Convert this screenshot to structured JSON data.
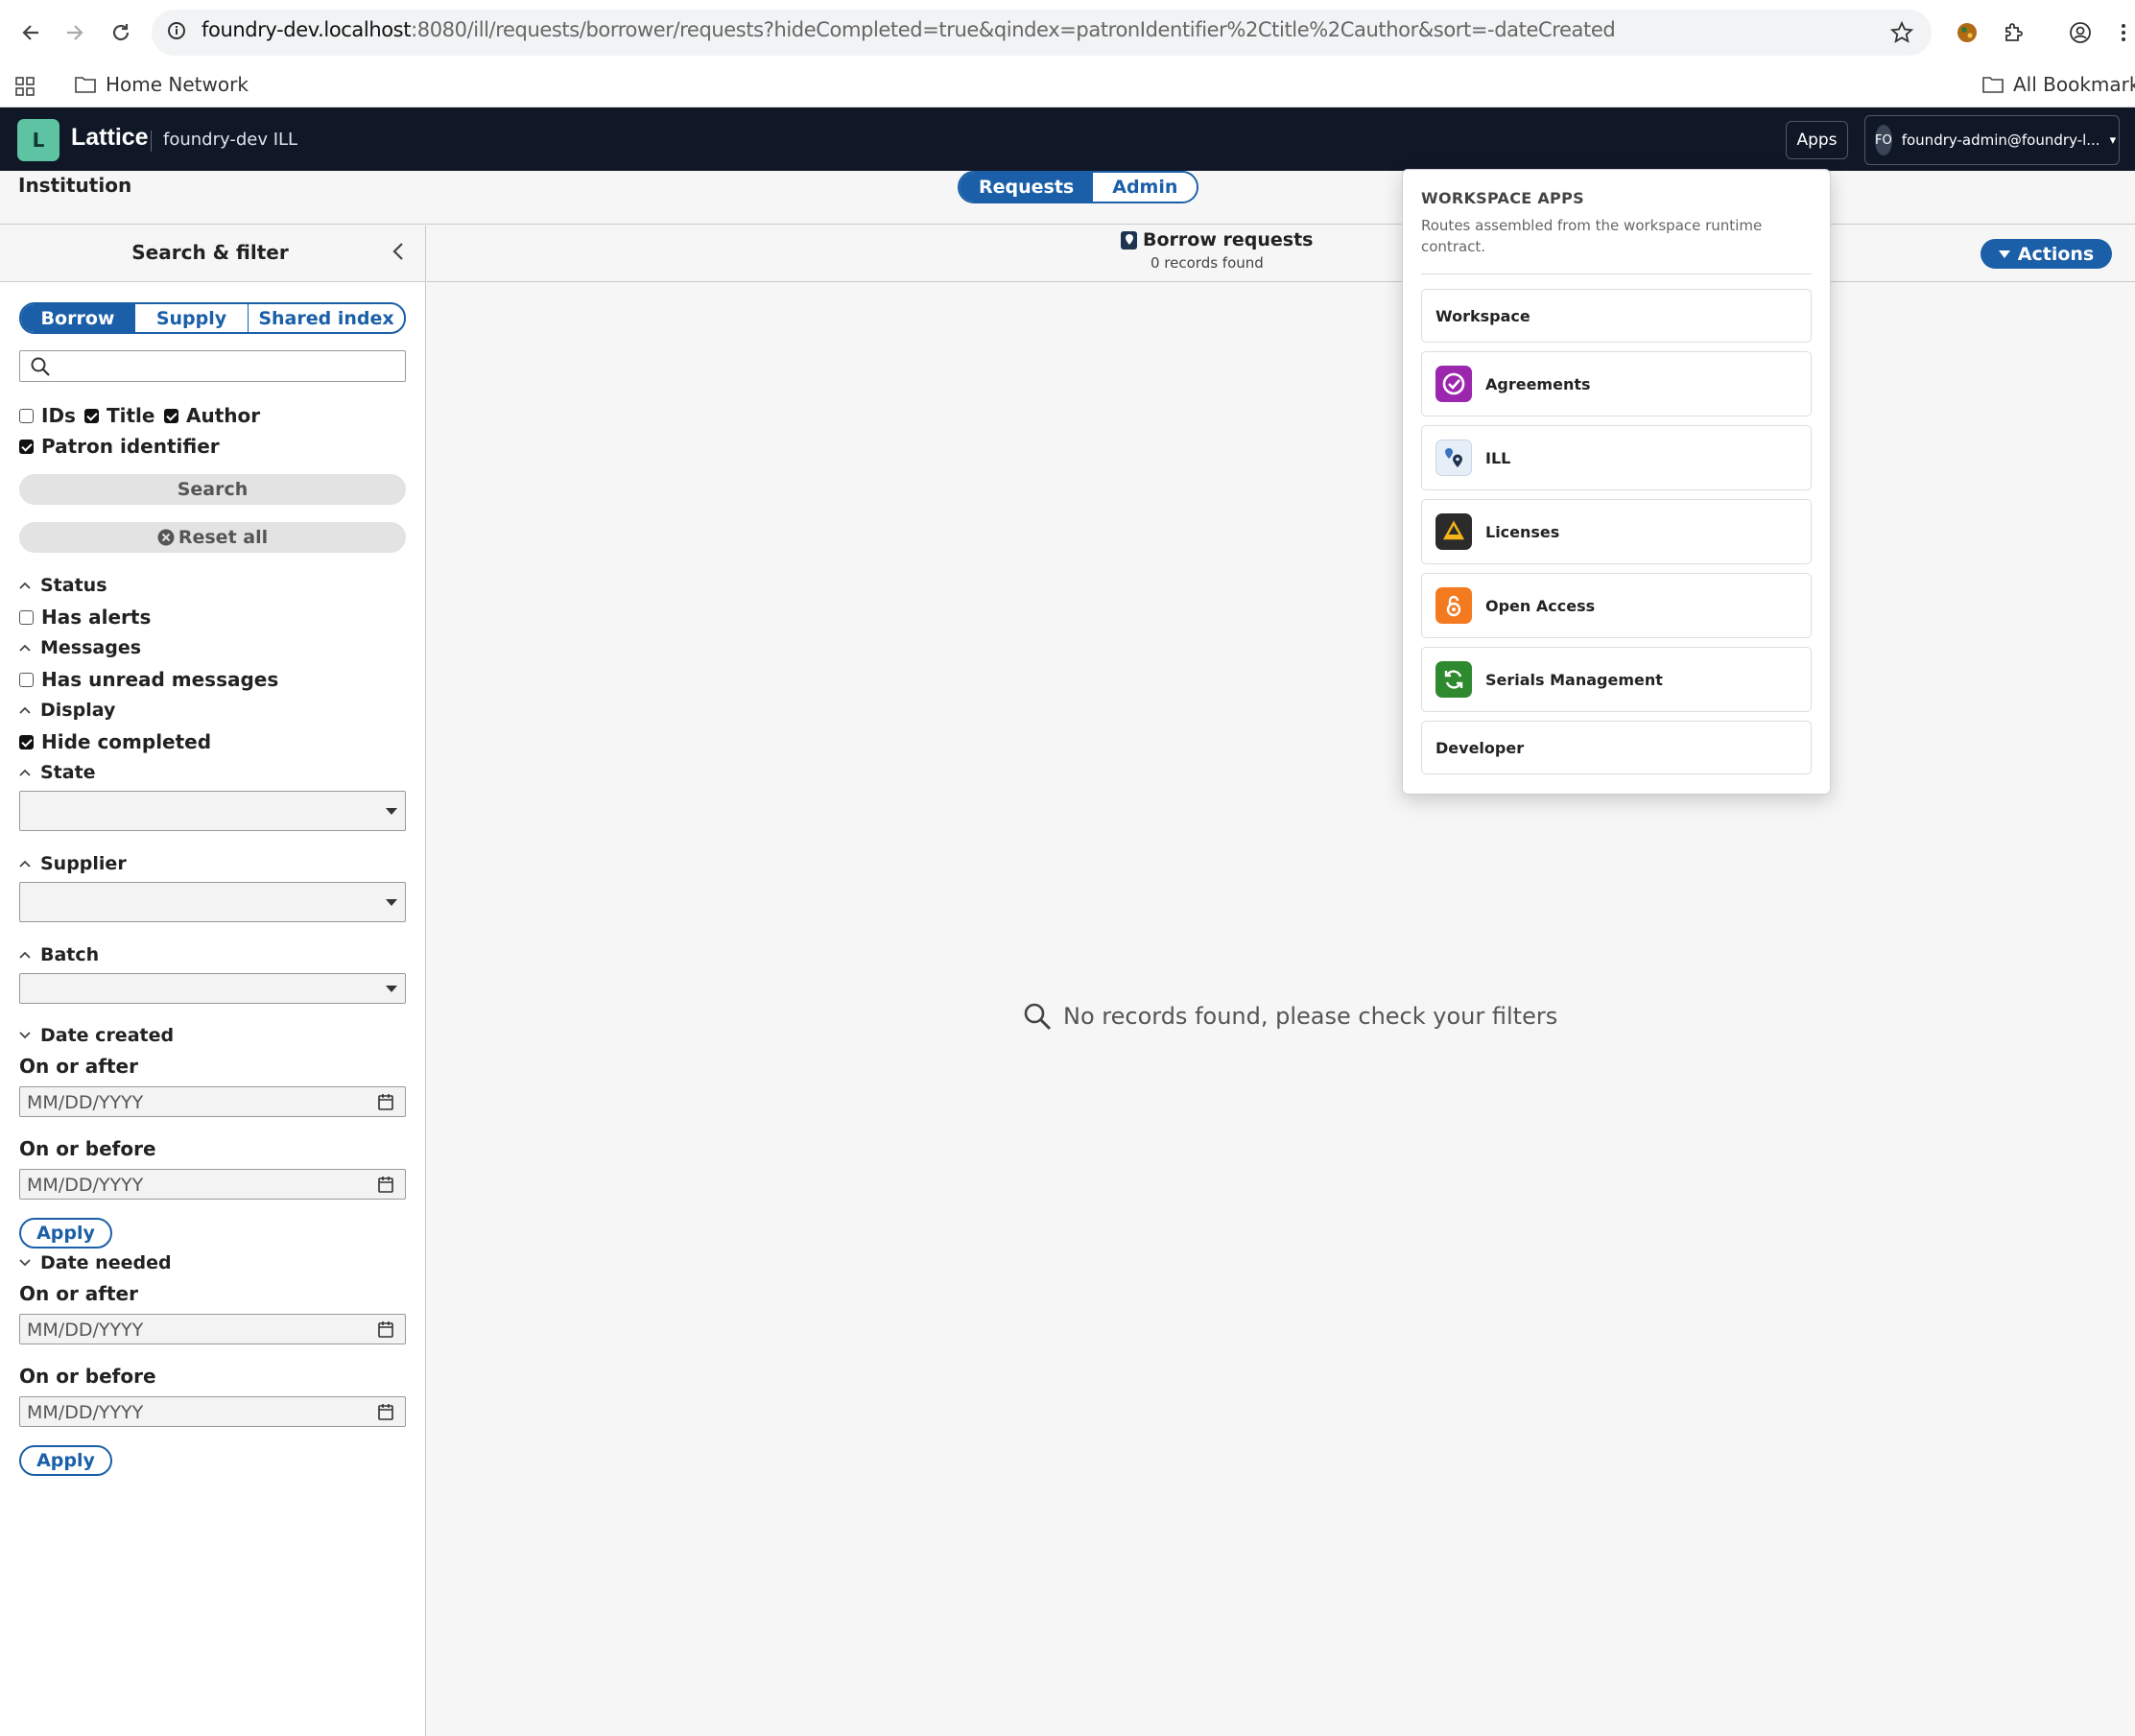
{
  "browser": {
    "url_host": "foundry-dev.localhost",
    "url_rest": ":8080/ill/requests/borrower/requests?hideCompleted=true&qindex=patronIdentifier%2Ctitle%2Cauthor&sort=-dateCreated",
    "bookmark_folder": "Home Network",
    "all_bookmarks": "All Bookmarks"
  },
  "header": {
    "logo_letter": "L",
    "brand": "Lattice",
    "workspace": "foundry-dev  ILL",
    "apps_label": "Apps",
    "user_initials": "FO",
    "user_name": "foundry-admin@foundry-l...",
    "user_caret": "▾"
  },
  "subheader": {
    "institution": "Institution",
    "tabs": [
      {
        "label": "Requests",
        "active": true
      },
      {
        "label": "Admin",
        "active": false
      }
    ]
  },
  "sidebar": {
    "title": "Search & filter",
    "segments": [
      "Borrow",
      "Supply",
      "Shared index"
    ],
    "search_value": "",
    "qindex": [
      {
        "label": "IDs",
        "checked": false
      },
      {
        "label": "Title",
        "checked": true
      },
      {
        "label": "Author",
        "checked": true
      },
      {
        "label": "Patron identifier",
        "checked": true
      }
    ],
    "search_button": "Search",
    "reset_button": "Reset all",
    "sections": {
      "status": "Status",
      "has_alerts": "Has alerts",
      "messages": "Messages",
      "has_unread": "Has unread messages",
      "display": "Display",
      "hide_completed": "Hide completed",
      "state": "State",
      "supplier": "Supplier",
      "batch": "Batch",
      "date_created": "Date created",
      "date_needed": "Date needed"
    },
    "on_or_after": "On or after",
    "on_or_before": "On or before",
    "date_placeholder": "MM/DD/YYYY",
    "apply": "Apply"
  },
  "main": {
    "title": "Borrow requests",
    "subtitle": "0 records found",
    "actions": "Actions",
    "empty": "No records found, please check your filters"
  },
  "apps_menu": {
    "heading": "WORKSPACE APPS",
    "description": "Routes assembled from the workspace runtime contract.",
    "items": [
      {
        "label": "Workspace",
        "icon": null
      },
      {
        "label": "Agreements",
        "icon": "agreements-icon",
        "color": "#9b27af"
      },
      {
        "label": "ILL",
        "icon": "ill-icon",
        "color": "#e6eef7"
      },
      {
        "label": "Licenses",
        "icon": "licenses-icon",
        "color": "#2b2b2b"
      },
      {
        "label": "Open Access",
        "icon": "open-access-icon",
        "color": "#f47a20"
      },
      {
        "label": "Serials Management",
        "icon": "serials-icon",
        "color": "#2f8a2f"
      },
      {
        "label": "Developer",
        "icon": null
      }
    ]
  }
}
